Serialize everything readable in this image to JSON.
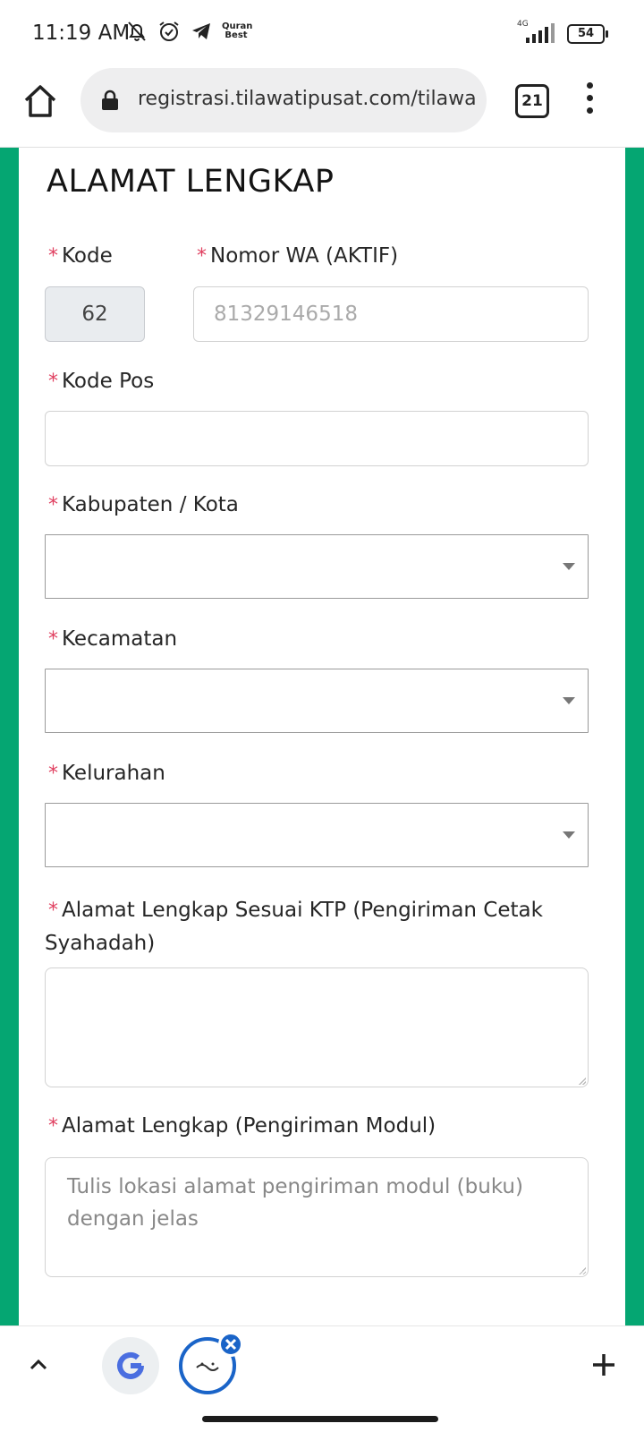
{
  "status_bar": {
    "time": "11:19 AM",
    "notification_icons": [
      "bell-muted-icon",
      "alarm-icon",
      "telegram-icon",
      "quran-best-icon"
    ],
    "quran_best_line1": "Quran",
    "quran_best_line2": "Best",
    "network": "4G",
    "battery": "54"
  },
  "browser": {
    "url": "registrasi.tilawatipusat.com/tilawa",
    "tab_count": "21"
  },
  "form": {
    "section_title": "ALAMAT LENGKAP",
    "required_mark": "*",
    "kode_label": "Kode",
    "kode_value": "62",
    "wa_label": "Nomor WA (AKTIF)",
    "wa_placeholder": "81329146518",
    "kode_pos_label": "Kode Pos",
    "kode_pos_value": "",
    "kabupaten_label": "Kabupaten / Kota",
    "kecamatan_label": "Kecamatan",
    "kelurahan_label": "Kelurahan",
    "alamat_ktp_label": "Alamat Lengkap Sesuai KTP (Pengiriman Cetak Syahadah)",
    "alamat_modul_label": "Alamat Lengkap (Pengiriman Modul)",
    "alamat_modul_placeholder": "Tulis lokasi alamat pengiriman modul (buku) dengan jelas"
  },
  "colors": {
    "accent_green": "#05a672",
    "required_red": "#e04060",
    "tab_blue": "#1a64c8"
  }
}
